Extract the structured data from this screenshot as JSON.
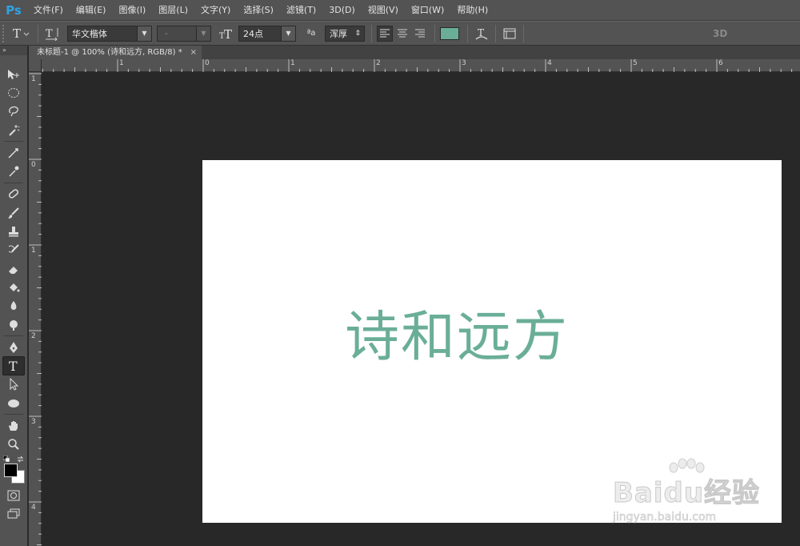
{
  "app": {
    "logo": "Ps",
    "menu": [
      "文件(F)",
      "编辑(E)",
      "图像(I)",
      "图层(L)",
      "文字(Y)",
      "选择(S)",
      "滤镜(T)",
      "3D(D)",
      "视图(V)",
      "窗口(W)",
      "帮助(H)"
    ]
  },
  "options": {
    "font_family": "华文楷体",
    "font_style": "-",
    "font_size": "24点",
    "aa_label": "ªa",
    "antialias": "浑厚",
    "text_color": "#6aae98",
    "mode_3d": "3D"
  },
  "document": {
    "tab_title": "未标题-1 @ 100% (诗和远方, RGB/8) *",
    "close": "×",
    "canvas_text": "诗和远方",
    "canvas_text_color": "#6aae98"
  },
  "rulers": {
    "horizontal": [
      "1",
      "0",
      "1",
      "2",
      "3",
      "4",
      "5",
      "6"
    ],
    "vertical": [
      "1",
      "0",
      "1",
      "2",
      "3",
      "4"
    ]
  },
  "watermark": {
    "logo": "Baidu经验",
    "sub": "jingyan.baidu.com"
  },
  "icons": {
    "tools": [
      "move-icon",
      "elliptical-marquee-icon",
      "lasso-icon",
      "magic-wand-icon",
      "crop-icon",
      "eyedropper-icon",
      "healing-brush-icon",
      "brush-icon",
      "clone-stamp-icon",
      "history-brush-icon",
      "eraser-icon",
      "paint-bucket-icon",
      "blur-icon",
      "dodge-icon",
      "pen-icon",
      "type-icon",
      "path-selection-icon",
      "ellipse-shape-icon",
      "hand-icon",
      "zoom-icon"
    ]
  }
}
